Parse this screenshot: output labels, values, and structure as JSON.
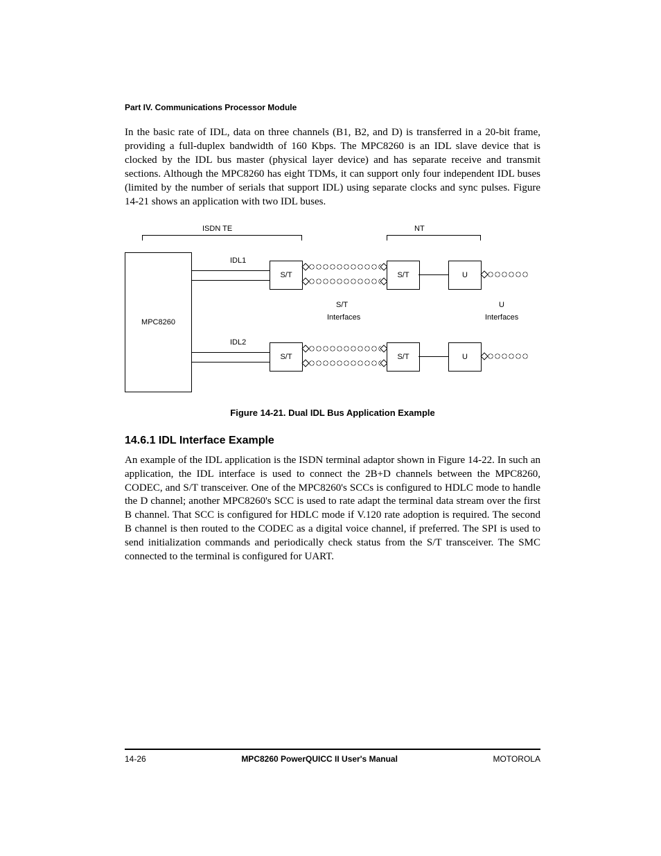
{
  "header": {
    "part": "Part IV.  Communications Processor Module"
  },
  "paragraphs": {
    "p1": "In the basic rate of IDL, data on three channels (B1, B2, and D) is transferred in a 20-bit frame, providing a full-duplex bandwidth of 160 Kbps. The MPC8260 is an IDL slave device that is clocked by the IDL bus master (physical layer device) and has separate receive and transmit sections. Although the MPC8260 has eight TDMs, it can support only four independent IDL buses (limited by the number of serials that support IDL) using separate clocks and sync pulses. Figure 14-21 shows an application with two IDL buses.",
    "p2": "An example of the IDL application is the ISDN terminal adaptor shown in Figure 14-22. In such an application, the IDL interface is used to connect the 2B+D channels between the MPC8260, CODEC, and S/T transceiver. One of the MPC8260's SCCs is configured to HDLC mode to handle the D channel; another MPC8260's SCC is used to rate adapt the terminal data stream over the first B channel. That SCC is configured for HDLC mode if V.120 rate adoption is required. The second B channel is then routed to the CODEC as a digital voice channel, if preferred. The SPI is used to send initialization commands and periodically check status from the S/T transceiver. The SMC connected to the terminal is configured for UART."
  },
  "figure": {
    "caption": "Figure 14-21. Dual IDL Bus Application Example",
    "isdn_te": "ISDN TE",
    "nt": "NT",
    "mpc8260": "MPC8260",
    "idl1": "IDL1",
    "idl2": "IDL2",
    "st": "S/T",
    "u": "U",
    "st_interfaces_1": "S/T",
    "st_interfaces_2": "Interfaces",
    "u_interfaces_1": "U",
    "u_interfaces_2": "Interfaces"
  },
  "subheading": "14.6.1  IDL Interface Example",
  "footer": {
    "left": "14-26",
    "center": "MPC8260 PowerQUICC II User's Manual",
    "right": "MOTOROLA"
  }
}
